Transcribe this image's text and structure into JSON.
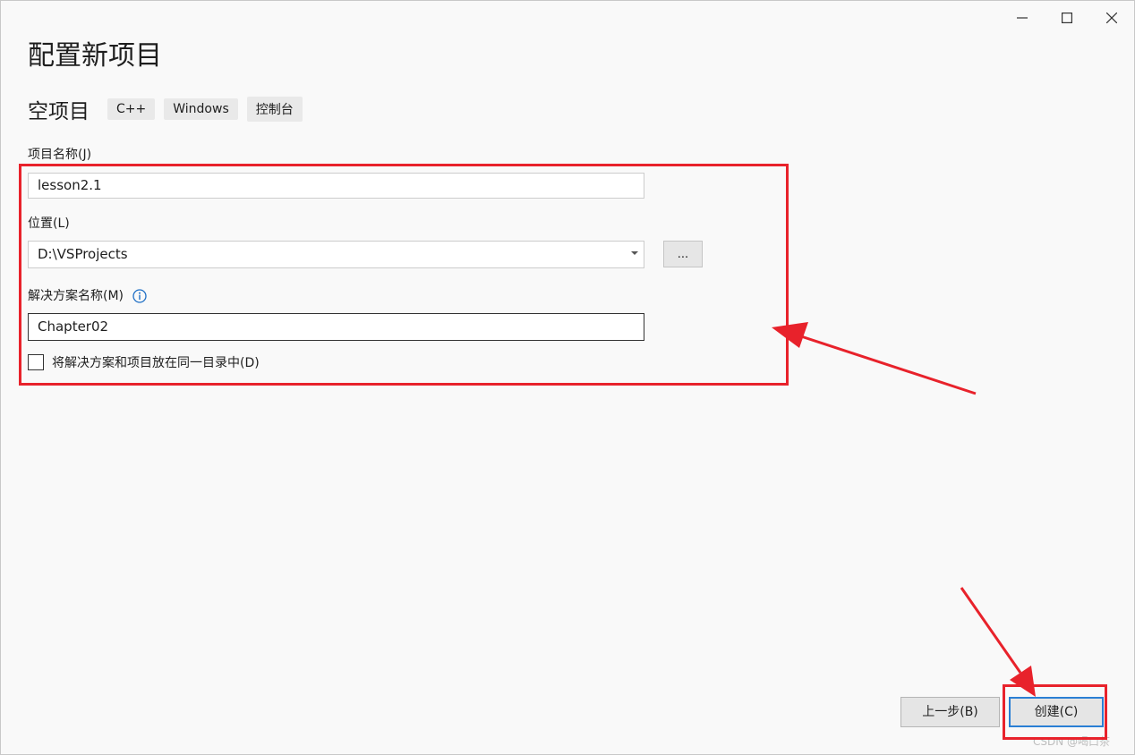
{
  "dialog": {
    "title": "配置新项目"
  },
  "window_controls": {
    "minimize": "minimize-icon",
    "maximize": "maximize-icon",
    "close": "close-icon"
  },
  "template": {
    "name": "空项目",
    "tags": [
      "C++",
      "Windows",
      "控制台"
    ]
  },
  "form": {
    "project_name_label": "项目名称(J)",
    "project_name_value": "lesson2.1",
    "location_label": "位置(L)",
    "location_value": "D:\\VSProjects",
    "browse_label": "...",
    "solution_name_label": "解决方案名称(M)",
    "solution_name_value": "Chapter02",
    "same_dir_checkbox_label": "将解决方案和项目放在同一目录中(D)",
    "same_dir_checked": false
  },
  "footer": {
    "back_label": "上一步(B)",
    "create_label": "创建(C)"
  },
  "annotation_color": "#e8222b",
  "watermark": "CSDN @喝口茶"
}
